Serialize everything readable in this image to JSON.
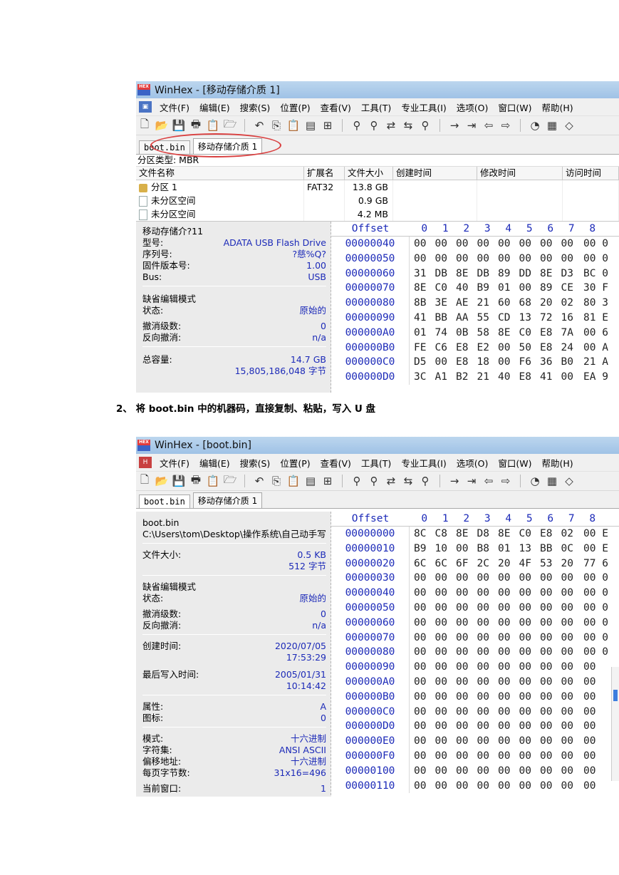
{
  "shot1": {
    "title": "WinHex - [移动存储介质 1]",
    "menu": [
      "文件(F)",
      "编辑(E)",
      "搜索(S)",
      "位置(P)",
      "查看(V)",
      "工具(T)",
      "专业工具(I)",
      "选项(O)",
      "窗口(W)",
      "帮助(H)"
    ],
    "tabs": [
      "boot.bin",
      "移动存储介质 1"
    ],
    "partition_type": "分区类型: MBR",
    "file_headers": [
      "文件名称",
      "扩展名",
      "文件大小",
      "创建时间",
      "修改时间",
      "访问时间"
    ],
    "files": [
      {
        "name": "分区 1",
        "ext": "FAT32",
        "size": "13.8 GB"
      },
      {
        "name": "未分区空间",
        "ext": "",
        "size": "0.9 GB"
      },
      {
        "name": "未分区空间",
        "ext": "",
        "size": "4.2 MB"
      }
    ],
    "info": {
      "device": "移动存储介?11",
      "model_label": "型号:",
      "model_value": "ADATA  USB Flash Drive",
      "serial_label": "序列号:",
      "serial_value": "?慈%Q?",
      "firmware_label": "固件版本号:",
      "firmware_value": "1.00",
      "bus_label": "Bus:",
      "bus_value": "USB",
      "edit_mode": "缺省编辑模式",
      "state_label": "状态:",
      "state_value": "原始的",
      "undo_label": "撤消级数:",
      "undo_value": "0",
      "redo_label": "反向撤消:",
      "redo_value": "n/a",
      "capacity_label": "总容量:",
      "capacity_value": "14.7 GB",
      "capacity_bytes": "15,805,186,048 字节"
    },
    "hex_header": {
      "offset": "Offset",
      "cols": [
        "0",
        "1",
        "2",
        "3",
        "4",
        "5",
        "6",
        "7",
        "8"
      ]
    },
    "hex_rows": [
      {
        "off": "00000040",
        "b": [
          "00",
          "00",
          "00",
          "00",
          "00",
          "00",
          "00",
          "00",
          "00 0"
        ]
      },
      {
        "off": "00000050",
        "b": [
          "00",
          "00",
          "00",
          "00",
          "00",
          "00",
          "00",
          "00",
          "00 0"
        ]
      },
      {
        "off": "00000060",
        "b": [
          "31",
          "DB",
          "8E",
          "DB",
          "89",
          "DD",
          "8E",
          "D3",
          "BC 0"
        ]
      },
      {
        "off": "00000070",
        "b": [
          "8E",
          "C0",
          "40",
          "B9",
          "01",
          "00",
          "89",
          "CE",
          "30 F"
        ]
      },
      {
        "off": "00000080",
        "b": [
          "8B",
          "3E",
          "AE",
          "21",
          "60",
          "68",
          "20",
          "02",
          "80 3"
        ]
      },
      {
        "off": "00000090",
        "b": [
          "41",
          "BB",
          "AA",
          "55",
          "CD",
          "13",
          "72",
          "16",
          "81 E"
        ]
      },
      {
        "off": "000000A0",
        "b": [
          "01",
          "74",
          "0B",
          "58",
          "8E",
          "C0",
          "E8",
          "7A",
          "00 6"
        ]
      },
      {
        "off": "000000B0",
        "b": [
          "FE",
          "C6",
          "E8",
          "E2",
          "00",
          "50",
          "E8",
          "24",
          "00 A"
        ]
      },
      {
        "off": "000000C0",
        "b": [
          "D5",
          "00",
          "E8",
          "18",
          "00",
          "F6",
          "36",
          "B0",
          "21 A"
        ]
      },
      {
        "off": "000000D0",
        "b": [
          "3C",
          "A1",
          "B2",
          "21",
          "40",
          "E8",
          "41",
          "00",
          "EA 9"
        ]
      }
    ]
  },
  "caption": "2、 将 boot.bin 中的机器码，直接复制、粘贴，写入 U 盘",
  "shot2": {
    "title": "WinHex - [boot.bin]",
    "menu": [
      "文件(F)",
      "编辑(E)",
      "搜索(S)",
      "位置(P)",
      "查看(V)",
      "工具(T)",
      "专业工具(I)",
      "选项(O)",
      "窗口(W)",
      "帮助(H)"
    ],
    "tabs": [
      "boot.bin",
      "移动存储介质 1"
    ],
    "info": {
      "filename": "boot.bin",
      "path": "C:\\Users\\tom\\Desktop\\操作系统\\自己动手写",
      "size_label": "文件大小:",
      "size_value": "0.5 KB",
      "size_bytes": "512 字节",
      "edit_mode": "缺省编辑模式",
      "state_label": "状态:",
      "state_value": "原始的",
      "undo_label": "撤消级数:",
      "undo_value": "0",
      "redo_label": "反向撤消:",
      "redo_value": "n/a",
      "created_label": "创建时间:",
      "created_date": "2020/07/05",
      "created_time": "17:53:29",
      "written_label": "最后写入时间:",
      "written_date": "2005/01/31",
      "written_time": "10:14:42",
      "attr_label": "属性:",
      "attr_value": "A",
      "icon_label": "图标:",
      "icon_value": "0",
      "mode_label": "模式:",
      "mode_value": "十六进制",
      "charset_label": "字符集:",
      "charset_value": "ANSI ASCII",
      "offset_label": "偏移地址:",
      "offset_value": "十六进制",
      "bpp_label": "每页字节数:",
      "bpp_value": "31x16=496",
      "window_label": "当前窗口:",
      "window_value": "1"
    },
    "hex_header": {
      "offset": "Offset",
      "cols": [
        "0",
        "1",
        "2",
        "3",
        "4",
        "5",
        "6",
        "7",
        "8"
      ]
    },
    "hex_rows": [
      {
        "off": "00000000",
        "b": [
          "8C",
          "C8",
          "8E",
          "D8",
          "8E",
          "C0",
          "E8",
          "02",
          "00 E"
        ]
      },
      {
        "off": "00000010",
        "b": [
          "B9",
          "10",
          "00",
          "B8",
          "01",
          "13",
          "BB",
          "0C",
          "00 E"
        ]
      },
      {
        "off": "00000020",
        "b": [
          "6C",
          "6C",
          "6F",
          "2C",
          "20",
          "4F",
          "53",
          "20",
          "77 6"
        ]
      },
      {
        "off": "00000030",
        "b": [
          "00",
          "00",
          "00",
          "00",
          "00",
          "00",
          "00",
          "00",
          "00 0"
        ]
      },
      {
        "off": "00000040",
        "b": [
          "00",
          "00",
          "00",
          "00",
          "00",
          "00",
          "00",
          "00",
          "00 0"
        ]
      },
      {
        "off": "00000050",
        "b": [
          "00",
          "00",
          "00",
          "00",
          "00",
          "00",
          "00",
          "00",
          "00 0"
        ]
      },
      {
        "off": "00000060",
        "b": [
          "00",
          "00",
          "00",
          "00",
          "00",
          "00",
          "00",
          "00",
          "00 0"
        ]
      },
      {
        "off": "00000070",
        "b": [
          "00",
          "00",
          "00",
          "00",
          "00",
          "00",
          "00",
          "00",
          "00 0"
        ]
      },
      {
        "off": "00000080",
        "b": [
          "00",
          "00",
          "00",
          "00",
          "00",
          "00",
          "00",
          "00",
          "00 0"
        ]
      },
      {
        "off": "00000090",
        "b": [
          "00",
          "00",
          "00",
          "00",
          "00",
          "00",
          "00",
          "00",
          "00"
        ]
      },
      {
        "off": "000000A0",
        "b": [
          "00",
          "00",
          "00",
          "00",
          "00",
          "00",
          "00",
          "00",
          "00"
        ]
      },
      {
        "off": "000000B0",
        "b": [
          "00",
          "00",
          "00",
          "00",
          "00",
          "00",
          "00",
          "00",
          "00"
        ]
      },
      {
        "off": "000000C0",
        "b": [
          "00",
          "00",
          "00",
          "00",
          "00",
          "00",
          "00",
          "00",
          "00"
        ]
      },
      {
        "off": "000000D0",
        "b": [
          "00",
          "00",
          "00",
          "00",
          "00",
          "00",
          "00",
          "00",
          "00"
        ]
      },
      {
        "off": "000000E0",
        "b": [
          "00",
          "00",
          "00",
          "00",
          "00",
          "00",
          "00",
          "00",
          "00"
        ]
      },
      {
        "off": "000000F0",
        "b": [
          "00",
          "00",
          "00",
          "00",
          "00",
          "00",
          "00",
          "00",
          "00"
        ]
      },
      {
        "off": "00000100",
        "b": [
          "00",
          "00",
          "00",
          "00",
          "00",
          "00",
          "00",
          "00",
          "00"
        ]
      },
      {
        "off": "00000110",
        "b": [
          "00",
          "00",
          "00",
          "00",
          "00",
          "00",
          "00",
          "00",
          "00"
        ]
      }
    ]
  }
}
